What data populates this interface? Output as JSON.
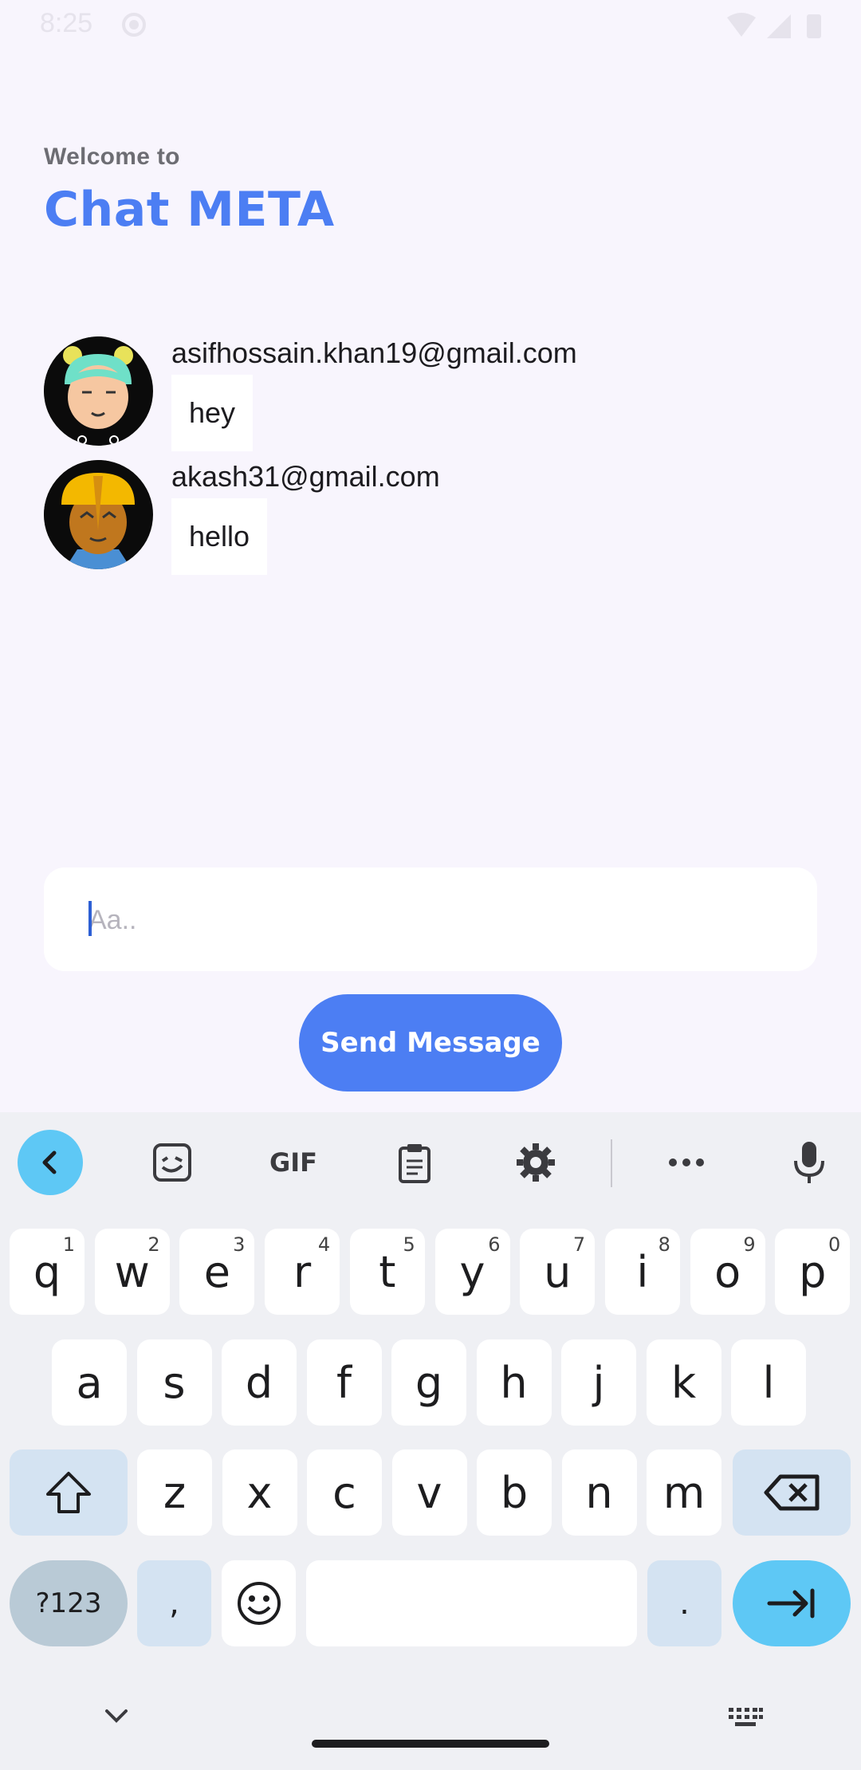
{
  "status_bar": {
    "time": "8:25"
  },
  "header": {
    "welcome": "Welcome to",
    "title": "Chat META"
  },
  "messages": [
    {
      "sender": "asifhossain.khan19@gmail.com",
      "text": "hey"
    },
    {
      "sender": "akash31@gmail.com",
      "text": "hello"
    }
  ],
  "composer": {
    "placeholder": "Aa..",
    "value": ""
  },
  "send_button": {
    "label": "Send Message"
  },
  "keyboard": {
    "toolbar": [
      "back-icon",
      "sticker-icon",
      "gif-icon",
      "clipboard-icon",
      "settings-icon",
      "more-icon",
      "mic-icon"
    ],
    "gif_label": "GIF",
    "row1": [
      {
        "k": "q",
        "n": "1"
      },
      {
        "k": "w",
        "n": "2"
      },
      {
        "k": "e",
        "n": "3"
      },
      {
        "k": "r",
        "n": "4"
      },
      {
        "k": "t",
        "n": "5"
      },
      {
        "k": "y",
        "n": "6"
      },
      {
        "k": "u",
        "n": "7"
      },
      {
        "k": "i",
        "n": "8"
      },
      {
        "k": "o",
        "n": "9"
      },
      {
        "k": "p",
        "n": "0"
      }
    ],
    "row2": [
      "a",
      "s",
      "d",
      "f",
      "g",
      "h",
      "j",
      "k",
      "l"
    ],
    "row3": [
      "z",
      "x",
      "c",
      "v",
      "b",
      "n",
      "m"
    ],
    "mode_label": "?123",
    "comma": ",",
    "period": "."
  },
  "colors": {
    "accent": "#4c7ef3",
    "keyboard_accent": "#5ec8f5",
    "background": "#f8f5fd"
  }
}
